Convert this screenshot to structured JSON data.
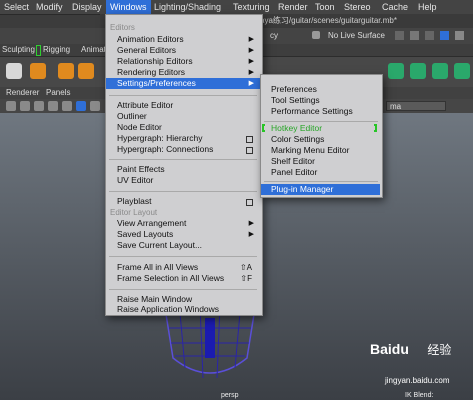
{
  "menubar": {
    "items": [
      "Select",
      "Modify",
      "Display",
      "Windows",
      "Lighting/Shading",
      "Texturing",
      "Render",
      "Toon",
      "Stereo",
      "Cache",
      "Help"
    ],
    "active": "Windows"
  },
  "title_path": "aya练习/guitar/scenes/guitarguitar.mb*",
  "shelf_tabs": [
    "Sculpting",
    "Rigging",
    "Animat"
  ],
  "shelf_partial_tab": "cy",
  "no_live_surface": "No Live Surface",
  "panel_menu": [
    "Renderer",
    "Panels"
  ],
  "viewport_dropdown": "ma",
  "viewport_label": "persp",
  "ik_blend_label": "IK Blend:",
  "watermark": {
    "brand": "Baidu",
    "brand_cn": "经验",
    "url": "jingyan.baidu.com"
  },
  "windows_menu": {
    "section_editors": "Editors",
    "group1": [
      {
        "label": "Animation Editors",
        "arrow": true
      },
      {
        "label": "General Editors",
        "arrow": true
      },
      {
        "label": "Relationship Editors",
        "arrow": true
      },
      {
        "label": "Rendering Editors",
        "arrow": true
      },
      {
        "label": "Settings/Preferences",
        "arrow": true,
        "highlight": true
      }
    ],
    "group2": [
      {
        "label": "Attribute Editor"
      },
      {
        "label": "Outliner"
      },
      {
        "label": "Node Editor"
      },
      {
        "label": "Hypergraph: Hierarchy",
        "box": true
      },
      {
        "label": "Hypergraph: Connections",
        "box": true
      }
    ],
    "group3": [
      {
        "label": "Paint Effects"
      },
      {
        "label": "UV Editor"
      }
    ],
    "group4": [
      {
        "label": "Playblast",
        "box": true
      }
    ],
    "section_layout": "Editor Layout",
    "group5": [
      {
        "label": "View Arrangement",
        "arrow": true
      },
      {
        "label": "Saved Layouts",
        "arrow": true
      },
      {
        "label": "Save Current Layout..."
      }
    ],
    "group6": [
      {
        "label": "Frame All in All Views",
        "shortcut": "⇧A"
      },
      {
        "label": "Frame Selection in All Views",
        "shortcut": "⇧F"
      }
    ],
    "group7": [
      {
        "label": "Raise Main Window"
      },
      {
        "label": "Raise Application Windows"
      }
    ]
  },
  "settings_submenu": {
    "group1": [
      "Preferences",
      "Tool Settings",
      "Performance Settings"
    ],
    "group2": [
      "Hotkey Editor",
      "Color Settings",
      "Marking Menu Editor",
      "Shelf Editor",
      "Panel Editor"
    ],
    "group3": [
      "Plug-in Manager"
    ]
  },
  "colors": {
    "highlight": "#2f6fd8",
    "hotkey_green": "#27a527",
    "menu_bg": "#cfcfd1"
  }
}
